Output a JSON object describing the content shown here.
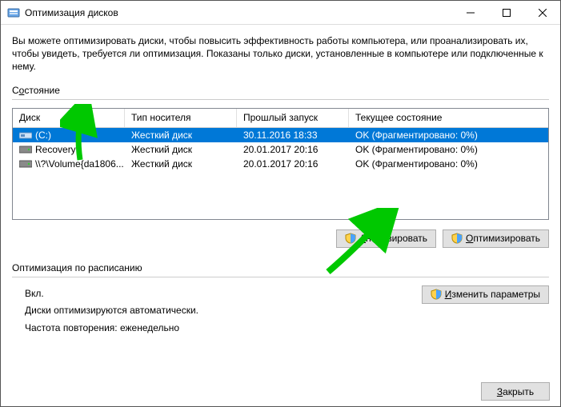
{
  "window": {
    "title": "Оптимизация дисков"
  },
  "intro": "Вы можете оптимизировать диски, чтобы повысить эффективность работы компьютера, или проанализировать их, чтобы увидеть, требуется ли оптимизация. Показаны только диски, установленные в компьютере или подключенные к нему.",
  "status_label_pre": "С",
  "status_label_ul": "о",
  "status_label_post": "стояние",
  "columns": {
    "disk": "Диск",
    "media": "Тип носителя",
    "last_run": "Прошлый запуск",
    "state": "Текущее состояние"
  },
  "rows": [
    {
      "name": "(C:)",
      "media": "Жесткий диск",
      "last_run": "30.11.2016 18:33",
      "state": "OK (Фрагментировано: 0%)",
      "icon": "drive",
      "selected": true
    },
    {
      "name": "Recovery",
      "media": "Жесткий диск",
      "last_run": "20.01.2017 20:16",
      "state": "OK (Фрагментировано: 0%)",
      "icon": "hdd",
      "selected": false
    },
    {
      "name": "\\\\?\\Volume{da1806...",
      "media": "Жесткий диск",
      "last_run": "20.01.2017 20:16",
      "state": "OK (Фрагментировано: 0%)",
      "icon": "hdd",
      "selected": false
    }
  ],
  "buttons": {
    "analyze_ul": "А",
    "analyze_rest": "нализировать",
    "optimize_ul": "О",
    "optimize_rest": "птимизировать",
    "change_ul": "И",
    "change_rest": "зменить параметры",
    "close_ul": "З",
    "close_rest": "акрыть"
  },
  "schedule": {
    "label": "Оптимизация по расписанию",
    "status": "Вкл.",
    "line1": "Диски оптимизируются автоматически.",
    "line2": "Частота повторения: еженедельно"
  }
}
